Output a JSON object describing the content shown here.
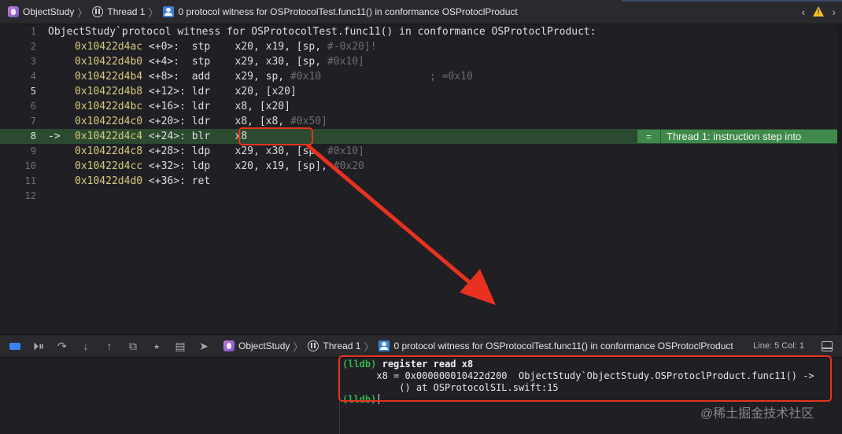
{
  "jumpbar": {
    "project": "ObjectStudy",
    "thread": "Thread 1",
    "frame": "0 protocol witness for OSProtocolTest.func11() in conformance OSProtoclProduct",
    "icons": [
      "app-icon",
      "thread-icon",
      "frame-icon",
      "chevron-left-icon",
      "chevron-right-icon",
      "warning-icon"
    ]
  },
  "editor": {
    "header_line": {
      "num": "1",
      "text": "ObjectStudy`protocol witness for OSProtocolTest.func11() in conformance OSProtoclProduct:"
    },
    "lines": [
      {
        "num": "2",
        "addr": "0x10422d4ac",
        "off": "<+0>: ",
        "op": "stp",
        "args": "x20, x19, [sp, ",
        "tail": "#-0x20]!",
        "comment": ""
      },
      {
        "num": "3",
        "addr": "0x10422d4b0",
        "off": "<+4>: ",
        "op": "stp",
        "args": "x29, x30, [sp, ",
        "tail": "#0x10]",
        "comment": ""
      },
      {
        "num": "4",
        "addr": "0x10422d4b4",
        "off": "<+8>: ",
        "op": "add",
        "args": "x29, sp, ",
        "tail": "#0x10",
        "comment": "; =0x10"
      },
      {
        "num": "5",
        "addr": "0x10422d4b8",
        "off": "<+12>:",
        "op": "ldr",
        "args": "x20, [x20]",
        "tail": "",
        "comment": ""
      },
      {
        "num": "6",
        "addr": "0x10422d4bc",
        "off": "<+16>:",
        "op": "ldr",
        "args": "x8, [x20]",
        "tail": "",
        "comment": ""
      },
      {
        "num": "7",
        "addr": "0x10422d4c0",
        "off": "<+20>:",
        "op": "ldr",
        "args": "x8, [x8, ",
        "tail": "#0x50]",
        "comment": ""
      },
      {
        "num": "8",
        "addr": "0x10422d4c4",
        "off": "<+24>:",
        "op": "blr",
        "args": "x8",
        "tail": "",
        "comment": ""
      },
      {
        "num": "9",
        "addr": "0x10422d4c8",
        "off": "<+28>:",
        "op": "ldp",
        "args": "x29, x30, [sp, ",
        "tail": "#0x10]",
        "comment": ""
      },
      {
        "num": "10",
        "addr": "0x10422d4cc",
        "off": "<+32>:",
        "op": "ldp",
        "args": "x20, x19, [sp], ",
        "tail": "#0x20",
        "comment": ""
      },
      {
        "num": "11",
        "addr": "0x10422d4d0",
        "off": "<+36>:",
        "op": "ret",
        "args": "",
        "tail": "",
        "comment": ""
      },
      {
        "num": "12",
        "addr": "",
        "off": "",
        "op": "",
        "args": "",
        "tail": "",
        "comment": ""
      }
    ],
    "current_marker": "->",
    "step_badge": "Thread 1: instruction step into",
    "step_badge_icon": "equals-icon"
  },
  "debugbar": {
    "icons": [
      "breakpoints-toggle-icon",
      "continue-icon",
      "step-over-icon",
      "step-into-icon",
      "step-out-icon",
      "debug-view-hierarchy-icon",
      "memory-graph-icon",
      "environment-overrides-icon",
      "simulate-location-icon"
    ],
    "project": "ObjectStudy",
    "thread": "Thread 1",
    "frame": "0 protocol witness for OSProtocolTest.func11() in conformance OSProtoclProduct",
    "position": "Line: 5  Col: 1"
  },
  "console": {
    "prompt": "(lldb)",
    "command": "register read x8",
    "output_line1": "x8 = 0x000000010422d200  ObjectStudy`ObjectStudy.OSProtoclProduct.func11() ->",
    "output_line2": "() at OSProtocolSIL.swift:15",
    "prompt2": "(lldb)"
  },
  "watermark": "@稀土掘金技术社区",
  "colors": {
    "accent_arrow": "#e8321f",
    "highlight_row": "#2b4a2f",
    "badge": "#3f8a4a",
    "address": "#d9c97c",
    "prompt": "#36b44a"
  }
}
